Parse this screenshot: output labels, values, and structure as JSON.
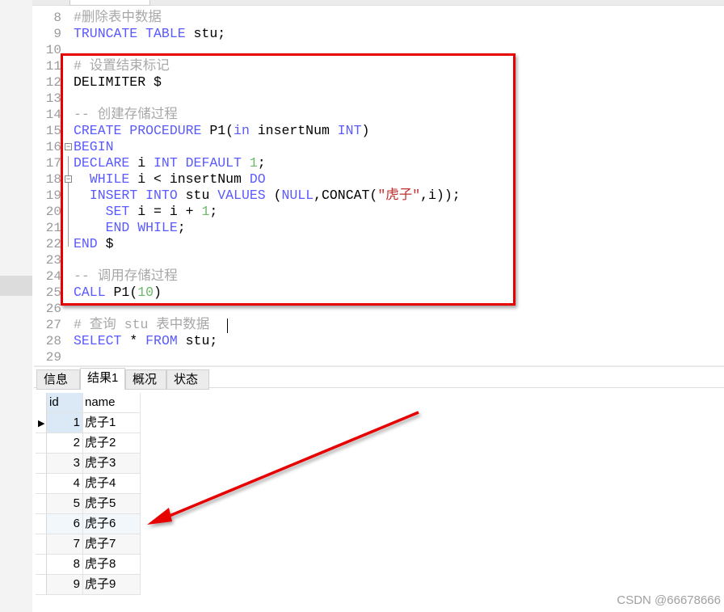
{
  "editor": {
    "lines": [
      {
        "n": "8",
        "tokens": [
          [
            "#删除表中数据",
            "cm"
          ]
        ]
      },
      {
        "n": "9",
        "tokens": [
          [
            "TRUNCATE TABLE",
            "kw"
          ],
          [
            " stu;",
            ""
          ]
        ]
      },
      {
        "n": "10",
        "tokens": []
      },
      {
        "n": "11",
        "tokens": [
          [
            "# 设置结束标记",
            "cm"
          ]
        ]
      },
      {
        "n": "12",
        "tokens": [
          [
            "DELIMITER $",
            ""
          ]
        ]
      },
      {
        "n": "13",
        "tokens": []
      },
      {
        "n": "14",
        "tokens": [
          [
            "-- 创建存储过程",
            "cm"
          ]
        ]
      },
      {
        "n": "15",
        "tokens": [
          [
            "CREATE PROCEDURE",
            "kw"
          ],
          [
            " P1(",
            ""
          ],
          [
            "in",
            "kw"
          ],
          [
            " insertNum ",
            ""
          ],
          [
            "INT",
            "kw"
          ],
          [
            ")",
            ""
          ]
        ]
      },
      {
        "n": "16",
        "tokens": [
          [
            "BEGIN",
            "kw"
          ]
        ]
      },
      {
        "n": "17",
        "tokens": [
          [
            "DECLARE",
            "kw"
          ],
          [
            " i ",
            ""
          ],
          [
            "INT DEFAULT",
            "kw"
          ],
          [
            " ",
            ""
          ],
          [
            "1",
            "num"
          ],
          [
            ";",
            ""
          ]
        ]
      },
      {
        "n": "18",
        "tokens": [
          [
            "  ",
            ""
          ],
          [
            "WHILE",
            "kw"
          ],
          [
            " i < insertNum ",
            ""
          ],
          [
            "DO",
            "kw"
          ]
        ]
      },
      {
        "n": "19",
        "tokens": [
          [
            "  ",
            ""
          ],
          [
            "INSERT INTO",
            "kw"
          ],
          [
            " stu ",
            ""
          ],
          [
            "VALUES",
            "kw"
          ],
          [
            " (",
            ""
          ],
          [
            "NULL",
            "kw"
          ],
          [
            ",CONCAT(",
            ""
          ],
          [
            "\"虎子\"",
            "str"
          ],
          [
            ",i));",
            ""
          ]
        ]
      },
      {
        "n": "20",
        "tokens": [
          [
            "    ",
            ""
          ],
          [
            "SET",
            "kw"
          ],
          [
            " i = i + ",
            ""
          ],
          [
            "1",
            "num"
          ],
          [
            ";",
            ""
          ]
        ]
      },
      {
        "n": "21",
        "tokens": [
          [
            "    ",
            ""
          ],
          [
            "END WHILE",
            "kw"
          ],
          [
            ";",
            ""
          ]
        ]
      },
      {
        "n": "22",
        "tokens": [
          [
            "END",
            "kw"
          ],
          [
            " $",
            ""
          ]
        ]
      },
      {
        "n": "23",
        "tokens": []
      },
      {
        "n": "24",
        "tokens": [
          [
            "-- 调用存储过程",
            "cm"
          ]
        ]
      },
      {
        "n": "25",
        "tokens": [
          [
            "CALL",
            "kw"
          ],
          [
            " P1(",
            ""
          ],
          [
            "10",
            "num"
          ],
          [
            ")",
            ""
          ]
        ]
      },
      {
        "n": "26",
        "tokens": []
      },
      {
        "n": "27",
        "tokens": [
          [
            "# 查询 stu 表中数据",
            "cm"
          ]
        ]
      },
      {
        "n": "28",
        "tokens": [
          [
            "SELECT",
            "kw"
          ],
          [
            " * ",
            ""
          ],
          [
            "FROM",
            "kw"
          ],
          [
            " stu;",
            ""
          ]
        ]
      },
      {
        "n": "29",
        "tokens": []
      }
    ]
  },
  "tabs": [
    {
      "label": "信息"
    },
    {
      "label": "结果1",
      "active": true
    },
    {
      "label": "概况"
    },
    {
      "label": "状态"
    }
  ],
  "grid": {
    "columns": [
      "id",
      "name"
    ],
    "rows": [
      [
        "1",
        "虎子1"
      ],
      [
        "2",
        "虎子2"
      ],
      [
        "3",
        "虎子3"
      ],
      [
        "4",
        "虎子4"
      ],
      [
        "5",
        "虎子5"
      ],
      [
        "6",
        "虎子6"
      ],
      [
        "7",
        "虎子7"
      ],
      [
        "8",
        "虎子8"
      ],
      [
        "9",
        "虎子9"
      ]
    ],
    "selected_row": 0
  },
  "annotation": {
    "highlight_color": "#e60000",
    "arrow_color": "#e60000"
  },
  "watermark": "CSDN @66678666"
}
